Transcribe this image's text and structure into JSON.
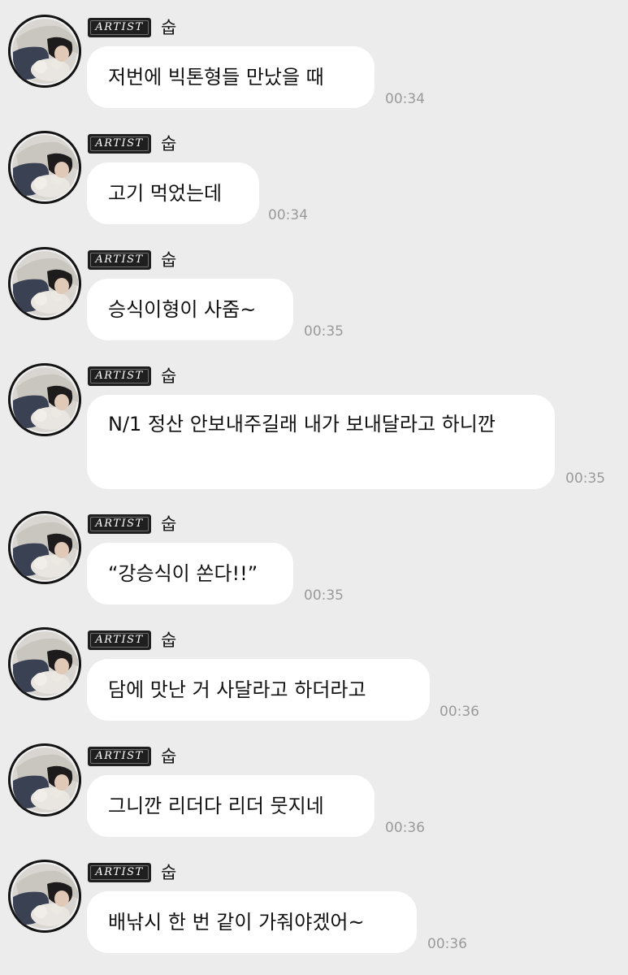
{
  "messages": [
    {
      "badge": "ARTIST",
      "sender": "숩",
      "text": "저번에 빅톤형들 만났을 때",
      "time": "00:34"
    },
    {
      "badge": "ARTIST",
      "sender": "숩",
      "text": "고기 먹었는데",
      "time": "00:34"
    },
    {
      "badge": "ARTIST",
      "sender": "숩",
      "text": "승식이형이 사줌~",
      "time": "00:35"
    },
    {
      "badge": "ARTIST",
      "sender": "숩",
      "text": " N/1 정산 안보내주길래 내가 보내달라고 하니깐",
      "time": "00:35"
    },
    {
      "badge": "ARTIST",
      "sender": "숩",
      "text": "“강승식이 쏜다!!”",
      "time": "00:35"
    },
    {
      "badge": "ARTIST",
      "sender": "숩",
      "text": " 담에 맛난 거 사달라고 하더라고",
      "time": "00:36"
    },
    {
      "badge": "ARTIST",
      "sender": "숩",
      "text": "그니깐 리더다 리더 뭇지네",
      "time": "00:36"
    },
    {
      "badge": "ARTIST",
      "sender": "숩",
      "text": "배낚시 한 번 같이 가줘야겠어~",
      "time": "00:36"
    }
  ],
  "colors": {
    "background": "#ececec",
    "bubble": "#ffffff",
    "badge": "#1f1f1f",
    "time": "#9a9a9a"
  },
  "icons": {
    "avatar": "profile-photo-avatar"
  }
}
